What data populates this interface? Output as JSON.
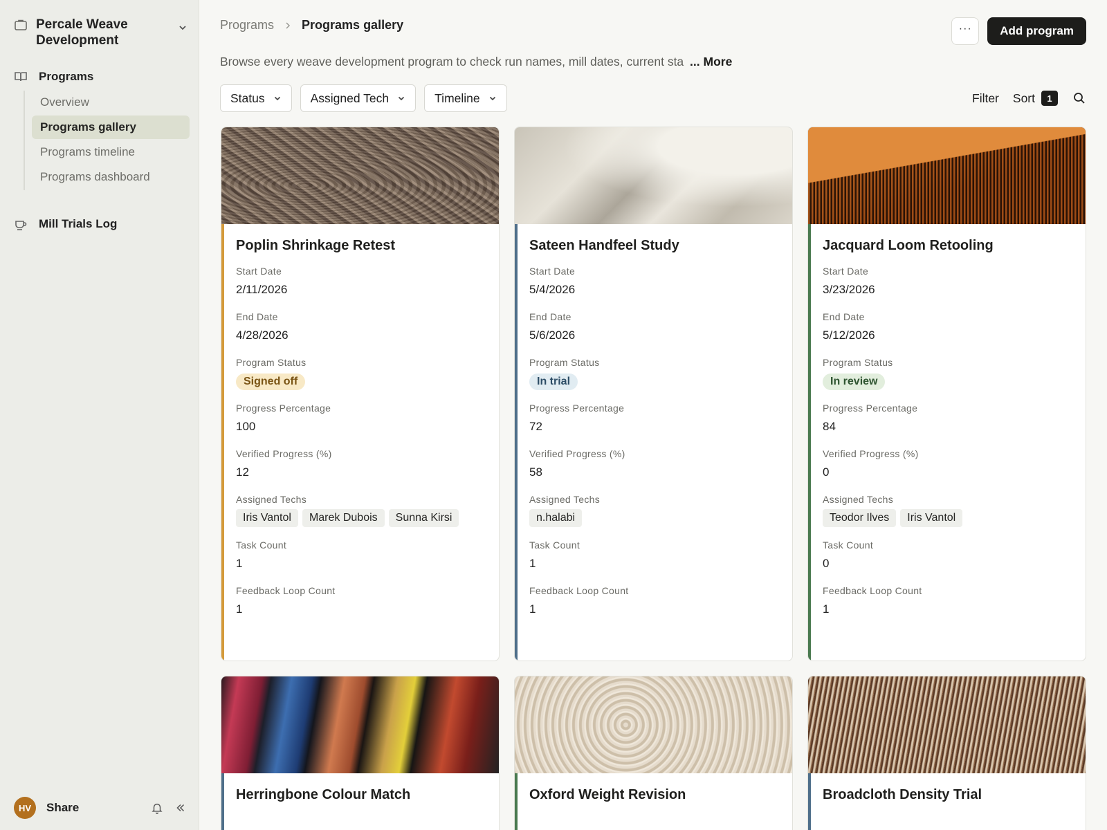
{
  "sidebar": {
    "workspace_title": "Percale Weave Development",
    "groups": [
      {
        "label": "Programs",
        "icon": "book-open-icon"
      },
      {
        "label": "Mill Trials Log",
        "icon": "coffee-cup-icon"
      }
    ],
    "sub_items": [
      {
        "label": "Overview",
        "active": false
      },
      {
        "label": "Programs gallery",
        "active": true
      },
      {
        "label": "Programs timeline",
        "active": false
      },
      {
        "label": "Programs dashboard",
        "active": false
      }
    ],
    "footer": {
      "avatar_initials": "HV",
      "share_label": "Share"
    }
  },
  "header": {
    "breadcrumb_parent": "Programs",
    "breadcrumb_current": "Programs gallery",
    "more_label": "···",
    "add_button": "Add program",
    "description": "Browse every weave development program to check run names, mill dates, current sta",
    "description_more": "... More"
  },
  "filters": {
    "buttons": [
      "Status",
      "Assigned Tech",
      "Timeline"
    ],
    "filter_label": "Filter",
    "sort_label": "Sort",
    "sort_count": "1"
  },
  "field_labels": {
    "start": "Start Date",
    "end": "End Date",
    "status": "Program Status",
    "progress": "Progress Percentage",
    "verified": "Verified Progress (%)",
    "techs": "Assigned Techs",
    "tasks": "Task Count",
    "feedback": "Feedback Loop Count"
  },
  "cards": [
    {
      "title": "Poplin Shrinkage Retest",
      "start_date": "2/11/2026",
      "end_date": "4/28/2026",
      "status": "Signed off",
      "status_bg": "#f8e9c6",
      "status_fg": "#7a5414",
      "accent": "#d49a3a",
      "progress": "100",
      "verified": "12",
      "techs": [
        "Iris Vantol",
        "Marek Dubois",
        "Sunna Kirsi"
      ],
      "tasks": "1",
      "feedback": "1"
    },
    {
      "title": "Sateen Handfeel Study",
      "start_date": "5/4/2026",
      "end_date": "5/6/2026",
      "status": "In trial",
      "status_bg": "#e1ecf2",
      "status_fg": "#2d4d66",
      "accent": "#4f6f8a",
      "progress": "72",
      "verified": "58",
      "techs": [
        "n.halabi"
      ],
      "tasks": "1",
      "feedback": "1"
    },
    {
      "title": "Jacquard Loom Retooling",
      "start_date": "3/23/2026",
      "end_date": "5/12/2026",
      "status": "In review",
      "status_bg": "#e2eedd",
      "status_fg": "#2e5430",
      "accent": "#4a7a50",
      "progress": "84",
      "verified": "0",
      "techs": [
        "Teodor Ilves",
        "Iris Vantol"
      ],
      "tasks": "0",
      "feedback": "1"
    },
    {
      "title": "Herringbone Colour Match",
      "accent": "#4f6f8a"
    },
    {
      "title": "Oxford Weight Revision",
      "accent": "#4a7a50"
    },
    {
      "title": "Broadcloth Density Trial",
      "accent": "#4f6f8a"
    }
  ]
}
